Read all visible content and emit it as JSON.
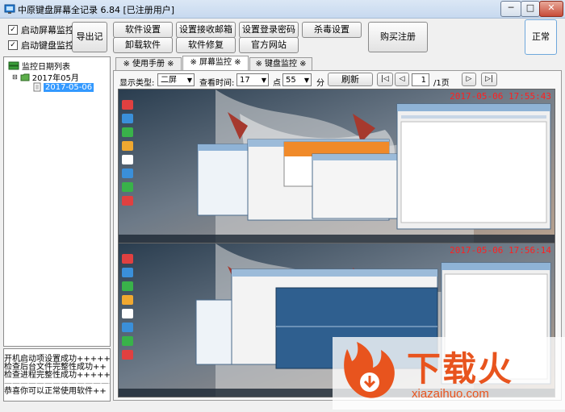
{
  "window": {
    "title": "中原键盘屏幕全记录 6.84 [已注册用户]",
    "minimize": "─",
    "maximize": "□",
    "close": "✕"
  },
  "options": {
    "screen_monitor": "启动屏幕监控",
    "keyboard_monitor": "启动键盘监控"
  },
  "toolbar": {
    "export": "导出记录",
    "settings": "软件设置",
    "email": "设置接收邮箱",
    "password": "设置登录密码",
    "antivirus": "杀毒设置",
    "uninstall": "卸载软件",
    "repair": "软件修复",
    "website": "官方网站",
    "buy": "购买注册",
    "status": "正常"
  },
  "tree": {
    "root": "监控日期列表",
    "month": "2017年05月",
    "day": "2017-05-06"
  },
  "log": {
    "lines": [
      "开机启动项设置成功+++++",
      "检查后台文件完整性成功++",
      "检查进程完整性成功+++++",
      "——————————————",
      "恭喜你可以正常使用软件++"
    ]
  },
  "tabs": [
    {
      "label": "※ 使用手册 ※"
    },
    {
      "label": "※ 屏幕监控 ※"
    },
    {
      "label": "※ 键盘监控 ※"
    }
  ],
  "controls": {
    "display_type_label": "显示类型:",
    "display_type_value": "二屏",
    "view_time_label": "查看时间:",
    "hour_value": "17",
    "hour_unit": "点",
    "minute_value": "55",
    "minute_unit": "分",
    "refresh": "刷新",
    "first": "|◁",
    "prev": "◁",
    "page_value": "1",
    "page_total": "/1页",
    "next": "▷",
    "last": "▷|"
  },
  "screenshots": [
    {
      "timestamp": "2017-05-06 17:55:43"
    },
    {
      "timestamp": "2017-05-06 17:56:14"
    }
  ],
  "watermark": {
    "brand": "下载火",
    "url": "xiazaihuo.com"
  },
  "colors": {
    "accent": "#3399ff",
    "timestamp": "#ff2020",
    "watermark": "#e8541e"
  }
}
